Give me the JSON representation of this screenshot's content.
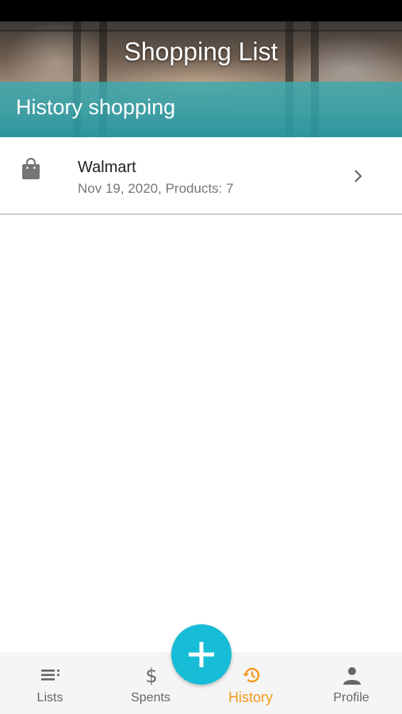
{
  "app": {
    "title": "Shopping List"
  },
  "section": {
    "title": "History shopping"
  },
  "history": [
    {
      "store": "Walmart",
      "details": "Nov 19, 2020, Products: 7",
      "icon": "shopping-bag-icon"
    }
  ],
  "nav": {
    "items": [
      {
        "label": "Lists",
        "icon": "list-icon"
      },
      {
        "label": "Spents",
        "icon": "dollar-icon"
      },
      {
        "label": "History",
        "icon": "history-icon",
        "active": true
      },
      {
        "label": "Profile",
        "icon": "person-icon"
      }
    ],
    "fab_icon": "plus-icon"
  },
  "colors": {
    "accent": "#17bcd6",
    "active_tab": "#f39a1c",
    "teal_band": "#2f9ba3"
  }
}
